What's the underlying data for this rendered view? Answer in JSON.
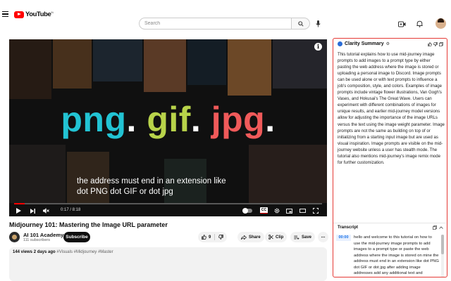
{
  "header": {
    "logo_text": "YouTube",
    "logo_region": "IN",
    "search_placeholder": "Search"
  },
  "player": {
    "headline_png": "png",
    "headline_gif": "gif",
    "headline_jpg": "jpg",
    "headline_dot": ".",
    "caption": "the address must end in an extension like dot PNG dot GIF or dot jpg",
    "time": "0:17 / 8:18",
    "progress_fraction": 0.035,
    "cc_label": "CC",
    "info_label": "i"
  },
  "video": {
    "title": "Midjourney 101: Mastering the Image URL parameter",
    "channel_name": "AI 101 Academy",
    "subscribers": "111 subscribers",
    "subscribe_label": "Subscribe",
    "like_count": "9",
    "share_label": "Share",
    "clip_label": "Clip",
    "save_label": "Save",
    "more_label": "...",
    "views_date": "144 views  2 days ago",
    "hashtags": "#Visuals #Midjourney #Master"
  },
  "clarity": {
    "title": "Clarity Summary",
    "summary": "This tutorial explains how to use mid-journey image prompts to add images to a prompt type by either pasting the web address where the image is stored or uploading a personal image to Discord. Image prompts can be used alone or with text prompts to influence a job's composition, style, and colors. Examples of image prompts include vintage flower illustrations, Van Gogh's Vases, and Hokusai's The Great Wave. Users can experiment with different combinations of images for unique results, and earlier mid-journey model versions allow for adjusting the importance of the image URLs versus the text using the image weight parameter. Image prompts are not the same as building on top of or initializing from a starting input image but are used as visual inspiration. Image prompts are visible on the mid-journey website unless a user has stealth mode. The tutorial also mentions mid-journey's image remix mode for further customization.",
    "transcript_label": "Transcript",
    "transcript_time": "00:00",
    "transcript_text": "hello and welcome to this tutorial on how to use the mid-journey image prompts to add images to a prompt type or paste the web address where the image is stored on mine the address must end in an extension like dot PNG dot GIF or dot jpg after adding image addresses add any additional text and parameters to complete the prompt you can use images as part of a prompt to influence a jobs composition style and colors"
  },
  "colors": {
    "brand_red": "#ff0000",
    "panel_border": "#e53935",
    "png_color": "#22c3d3",
    "gif_color": "#b8d34a",
    "jpg_color": "#f05a5a",
    "timestamp_blue": "#1a73e8"
  }
}
